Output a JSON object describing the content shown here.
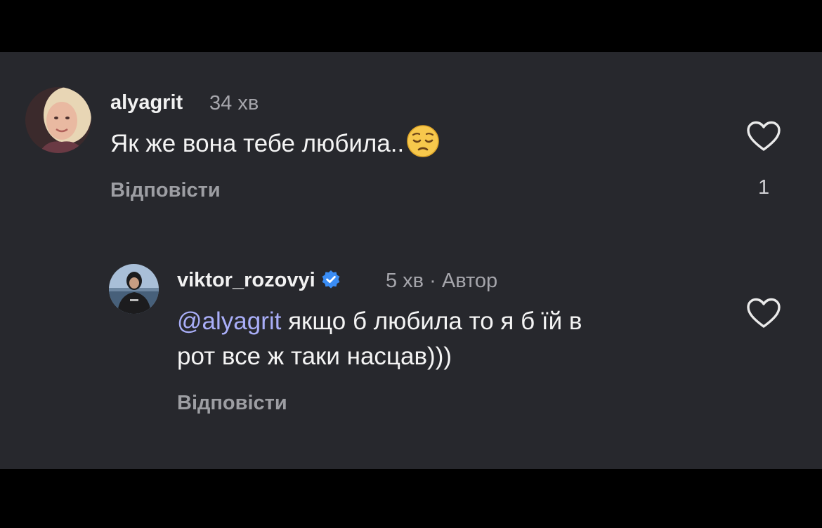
{
  "colors": {
    "background": "#27282d",
    "letterbox": "#000000",
    "username": "#f2f2f2",
    "meta": "#a5a5ab",
    "mention": "#a9aef8",
    "verified_badge": "#3a8df5"
  },
  "comments": [
    {
      "username": "alyagrit",
      "time": "34 хв",
      "text": "Як же вона тебе любила..",
      "emoji_icon": "pensive-face-icon",
      "reply_label": "Відповісти",
      "like_count": "1"
    },
    {
      "username": "viktor_rozovyi",
      "verified": true,
      "time": "5 хв · Автор",
      "mention": "@alyagrit",
      "text_line1": " якщо б любила то я б їй в",
      "text_line2": "рот все ж таки насцав)))",
      "reply_label": "Відповісти"
    }
  ]
}
